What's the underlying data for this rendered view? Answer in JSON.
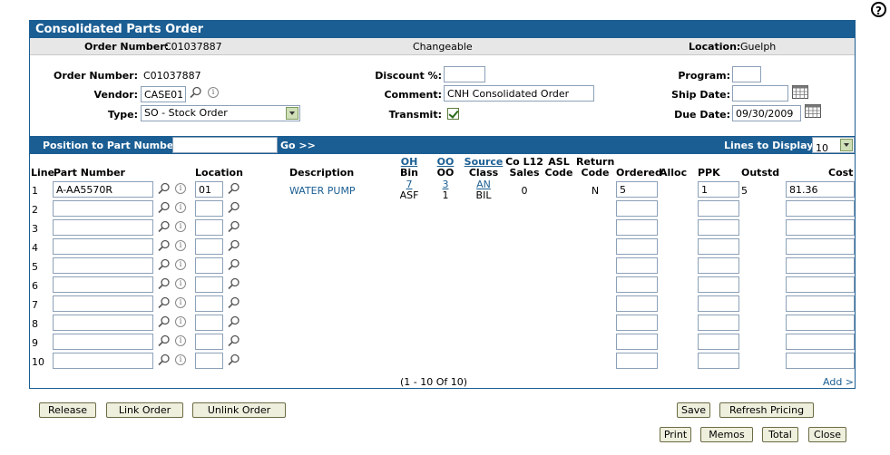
{
  "help": {
    "icon": "?"
  },
  "title": "Consolidated Parts Order",
  "info": {
    "order_label": "Order Number:",
    "order_value": "C01037887",
    "status": "Changeable",
    "location_label": "Location:",
    "location_value": "Guelph"
  },
  "form": {
    "order_number_label": "Order Number:",
    "order_number_value": "C01037887",
    "vendor_label": "Vendor:",
    "vendor_value": "CASE01",
    "type_label": "Type:",
    "type_value": "SO - Stock Order",
    "discount_label": "Discount %:",
    "discount_value": "",
    "comment_label": "Comment:",
    "comment_value": "CNH Consolidated Order",
    "transmit_label": "Transmit:",
    "transmit_checked": true,
    "program_label": "Program:",
    "program_value": "",
    "ship_date_label": "Ship Date:",
    "ship_date_value": "",
    "due_date_label": "Due Date:",
    "due_date_value": "09/30/2009"
  },
  "position": {
    "label": "Position to Part Number:",
    "value": "",
    "go_label": "Go >>",
    "lines_label": "Lines to Display:",
    "lines_value": "10"
  },
  "columns": {
    "line": "Line",
    "part": "Part Number",
    "location": "Location",
    "description": "Description",
    "oh_top": "OH",
    "oh_bottom": "Bin",
    "oo_top": "OO",
    "oo_bottom": "OO",
    "source_top": "Source",
    "source_bottom": "Class",
    "co_top": "Co L12",
    "co_bottom": "Sales",
    "asl_top": "ASL",
    "asl_bottom": "Code",
    "ret_top": "Return",
    "ret_bottom": "Code",
    "ordered": "Ordered",
    "alloc": "Alloc",
    "ppk": "PPK",
    "outstd": "Outstd",
    "cost": "Cost"
  },
  "rows": [
    {
      "line": "1",
      "part": "A-AA5570R",
      "location": "01",
      "description": "WATER PUMP",
      "oh": "7",
      "bin": "ASF",
      "oo": "3",
      "oo2": "1",
      "source": "AN",
      "class": "BIL",
      "sales": "0",
      "asl": "",
      "return_code": "N",
      "ordered": "5",
      "ppk": "1",
      "outstd": "5",
      "cost": "81.36"
    },
    {
      "line": "2",
      "part": "",
      "location": "",
      "description": "",
      "oh": "",
      "bin": "",
      "oo": "",
      "oo2": "",
      "source": "",
      "class": "",
      "sales": "",
      "asl": "",
      "return_code": "",
      "ordered": "",
      "ppk": "",
      "outstd": "",
      "cost": ""
    },
    {
      "line": "3",
      "part": "",
      "location": "",
      "description": "",
      "oh": "",
      "bin": "",
      "oo": "",
      "oo2": "",
      "source": "",
      "class": "",
      "sales": "",
      "asl": "",
      "return_code": "",
      "ordered": "",
      "ppk": "",
      "outstd": "",
      "cost": ""
    },
    {
      "line": "4",
      "part": "",
      "location": "",
      "description": "",
      "oh": "",
      "bin": "",
      "oo": "",
      "oo2": "",
      "source": "",
      "class": "",
      "sales": "",
      "asl": "",
      "return_code": "",
      "ordered": "",
      "ppk": "",
      "outstd": "",
      "cost": ""
    },
    {
      "line": "5",
      "part": "",
      "location": "",
      "description": "",
      "oh": "",
      "bin": "",
      "oo": "",
      "oo2": "",
      "source": "",
      "class": "",
      "sales": "",
      "asl": "",
      "return_code": "",
      "ordered": "",
      "ppk": "",
      "outstd": "",
      "cost": ""
    },
    {
      "line": "6",
      "part": "",
      "location": "",
      "description": "",
      "oh": "",
      "bin": "",
      "oo": "",
      "oo2": "",
      "source": "",
      "class": "",
      "sales": "",
      "asl": "",
      "return_code": "",
      "ordered": "",
      "ppk": "",
      "outstd": "",
      "cost": ""
    },
    {
      "line": "7",
      "part": "",
      "location": "",
      "description": "",
      "oh": "",
      "bin": "",
      "oo": "",
      "oo2": "",
      "source": "",
      "class": "",
      "sales": "",
      "asl": "",
      "return_code": "",
      "ordered": "",
      "ppk": "",
      "outstd": "",
      "cost": ""
    },
    {
      "line": "8",
      "part": "",
      "location": "",
      "description": "",
      "oh": "",
      "bin": "",
      "oo": "",
      "oo2": "",
      "source": "",
      "class": "",
      "sales": "",
      "asl": "",
      "return_code": "",
      "ordered": "",
      "ppk": "",
      "outstd": "",
      "cost": ""
    },
    {
      "line": "9",
      "part": "",
      "location": "",
      "description": "",
      "oh": "",
      "bin": "",
      "oo": "",
      "oo2": "",
      "source": "",
      "class": "",
      "sales": "",
      "asl": "",
      "return_code": "",
      "ordered": "",
      "ppk": "",
      "outstd": "",
      "cost": ""
    },
    {
      "line": "10",
      "part": "",
      "location": "",
      "description": "",
      "oh": "",
      "bin": "",
      "oo": "",
      "oo2": "",
      "source": "",
      "class": "",
      "sales": "",
      "asl": "",
      "return_code": "",
      "ordered": "",
      "ppk": "",
      "outstd": "",
      "cost": ""
    }
  ],
  "pagination": "(1  -  10  Of  10)",
  "add_link": "Add >",
  "buttons": {
    "release": "Release",
    "link_order": "Link Order",
    "unlink_order": "Unlink Order",
    "save": "Save",
    "refresh_pricing": "Refresh Pricing",
    "print": "Print",
    "memos": "Memos",
    "total": "Total",
    "close": "Close"
  },
  "colors": {
    "header_blue": "#1b5e93",
    "link_blue": "#1b5e93",
    "button_bg": "#efefde"
  }
}
